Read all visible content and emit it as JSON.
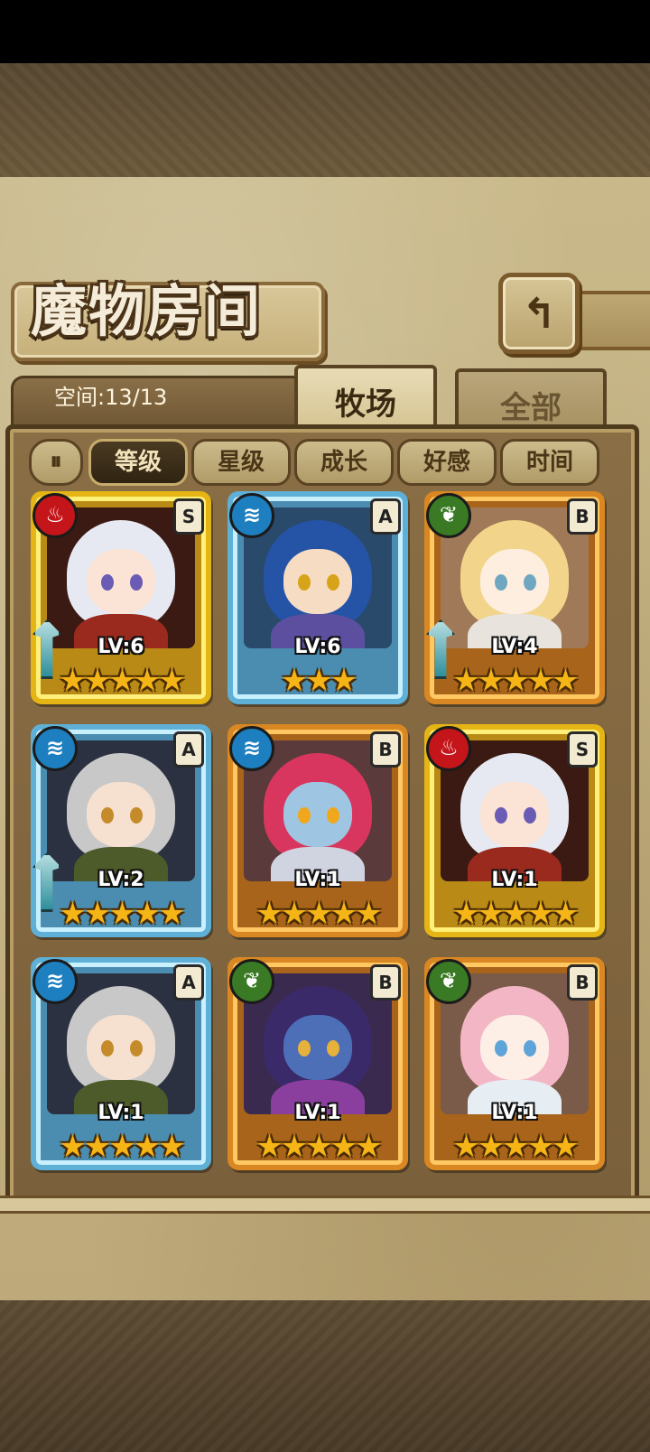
{
  "header": {
    "title": "魔物房间",
    "back_icon": "↰"
  },
  "space": {
    "label": "空间:13/13"
  },
  "tabs": [
    {
      "label": "牧场",
      "active": true
    },
    {
      "label": "全部",
      "active": false
    }
  ],
  "filter_toggle": {
    "icon": "⏸"
  },
  "sort_buttons": [
    {
      "label": "等级",
      "active": true
    },
    {
      "label": "星级",
      "active": false
    },
    {
      "label": "成长",
      "active": false
    },
    {
      "label": "好感",
      "active": false
    },
    {
      "label": "时间",
      "active": false
    }
  ],
  "monsters": [
    {
      "level": "LV:6",
      "rank": "S",
      "element": "fire",
      "element_icon": "♨",
      "stars": 5,
      "stars_text": "★★★★★",
      "frame": "gold",
      "weapon": true,
      "colors": {
        "portrait": "#3a1a12",
        "hair": "#e6e9f2",
        "skin": "#fbe4d6",
        "eye": "#6a5bb5",
        "outfit": "#9a2a1e"
      }
    },
    {
      "level": "LV:6",
      "rank": "A",
      "element": "water",
      "element_icon": "≋",
      "stars": 3,
      "stars_text": "★★★",
      "frame": "blue",
      "weapon": false,
      "colors": {
        "portrait": "#294a6b",
        "hair": "#2553a6",
        "skin": "#f6dcc2",
        "eye": "#d7a318",
        "outfit": "#5d4fa0"
      }
    },
    {
      "level": "LV:4",
      "rank": "B",
      "element": "nature",
      "element_icon": "❦",
      "stars": 5,
      "stars_text": "★★★★★",
      "frame": "orange",
      "weapon": true,
      "colors": {
        "portrait": "#a07a58",
        "hair": "#f2d58a",
        "skin": "#fdeee0",
        "eye": "#6fa7c0",
        "outfit": "#e8e4dd"
      }
    },
    {
      "level": "LV:2",
      "rank": "A",
      "element": "water",
      "element_icon": "≋",
      "stars": 5,
      "stars_text": "★★★★★",
      "frame": "blue",
      "weapon": true,
      "colors": {
        "portrait": "#2b3140",
        "hair": "#c8c8c8",
        "skin": "#f6e0cf",
        "eye": "#c58b2a",
        "outfit": "#4d5a2a"
      }
    },
    {
      "level": "LV:1",
      "rank": "B",
      "element": "water",
      "element_icon": "≋",
      "stars": 5,
      "stars_text": "★★★★★",
      "frame": "orange",
      "weapon": false,
      "colors": {
        "portrait": "#5a3a3a",
        "hair": "#d8365e",
        "skin": "#9ec6e3",
        "eye": "#f1a71c",
        "outfit": "#d0d3e0"
      }
    },
    {
      "level": "LV:1",
      "rank": "S",
      "element": "fire",
      "element_icon": "♨",
      "stars": 5,
      "stars_text": "★★★★★",
      "frame": "gold",
      "weapon": false,
      "colors": {
        "portrait": "#3a1a12",
        "hair": "#e6e9f2",
        "skin": "#fbe4d6",
        "eye": "#6a5bb5",
        "outfit": "#9a2a1e"
      }
    },
    {
      "level": "LV:1",
      "rank": "A",
      "element": "water",
      "element_icon": "≋",
      "stars": 5,
      "stars_text": "★★★★★",
      "frame": "blue",
      "weapon": false,
      "colors": {
        "portrait": "#2b3140",
        "hair": "#c8c8c8",
        "skin": "#f6e0cf",
        "eye": "#c58b2a",
        "outfit": "#4d5a2a"
      }
    },
    {
      "level": "LV:1",
      "rank": "B",
      "element": "nature",
      "element_icon": "❦",
      "stars": 5,
      "stars_text": "★★★★★",
      "frame": "orange",
      "weapon": false,
      "colors": {
        "portrait": "#3a2a4f",
        "hair": "#3b2a6a",
        "skin": "#4c6fb8",
        "eye": "#e7b23b",
        "outfit": "#8a3f9e"
      }
    },
    {
      "level": "LV:1",
      "rank": "B",
      "element": "nature",
      "element_icon": "❦",
      "stars": 5,
      "stars_text": "★★★★★",
      "frame": "orange",
      "weapon": false,
      "colors": {
        "portrait": "#7a5a48",
        "hair": "#f3b6c5",
        "skin": "#fdeee6",
        "eye": "#5ea4d8",
        "outfit": "#e6eef4"
      }
    }
  ]
}
